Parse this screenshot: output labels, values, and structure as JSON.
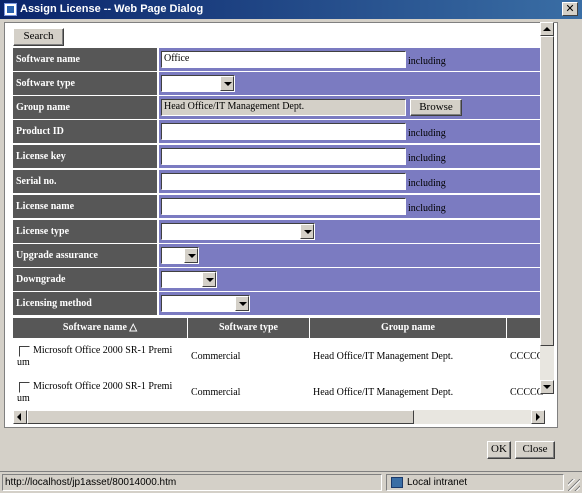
{
  "window": {
    "title": "Assign License -- Web Page Dialog",
    "close_glyph": "✕"
  },
  "toolbar": {
    "search_label": "Search"
  },
  "form": {
    "software_name": {
      "label": "Software name",
      "value": "Office",
      "suffix": "including"
    },
    "software_type": {
      "label": "Software type",
      "value": ""
    },
    "group_name": {
      "label": "Group name",
      "value": "Head Office/IT Management Dept.",
      "browse_label": "Browse"
    },
    "product_id": {
      "label": "Product ID",
      "value": "",
      "suffix": "including"
    },
    "license_key": {
      "label": "License key",
      "value": "",
      "suffix": "including"
    },
    "serial_no": {
      "label": "Serial no.",
      "value": "",
      "suffix": "including"
    },
    "license_name": {
      "label": "License name",
      "value": "",
      "suffix": "including"
    },
    "license_type": {
      "label": "License type",
      "value": ""
    },
    "upgrade_assurance": {
      "label": "Upgrade assurance",
      "value": ""
    },
    "downgrade": {
      "label": "Downgrade",
      "value": ""
    },
    "licensing_method": {
      "label": "Licensing method",
      "value": ""
    }
  },
  "grid": {
    "columns": [
      "Software name",
      "Software type",
      "Group name",
      ""
    ],
    "sort_indicator": "△",
    "rows": [
      {
        "name_line1": "Microsoft Office 2000 SR-1 Premi",
        "name_line2": "um",
        "type": "Commercial",
        "group": "Head Office/IT Management Dept.",
        "extra": "CCCCC"
      },
      {
        "name_line1": "Microsoft Office 2000 SR-1 Premi",
        "name_line2": "um",
        "type": "Commercial",
        "group": "Head Office/IT Management Dept.",
        "extra": "CCCCC"
      }
    ]
  },
  "buttons": {
    "ok_label": "OK",
    "close_label": "Close"
  },
  "status": {
    "url": "http://localhost/jp1asset/80014000.htm",
    "zone": "Local intranet"
  },
  "colors": {
    "label_bg": "#575757",
    "value_bg": "#7b7bc1",
    "title_bar": "#0a246a"
  }
}
